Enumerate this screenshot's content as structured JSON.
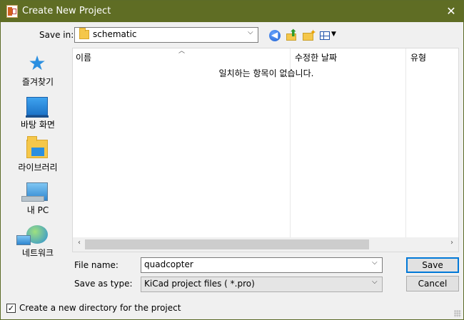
{
  "window": {
    "title": "Create New Project",
    "close_glyph": "✕"
  },
  "save_in": {
    "label": "Save in:",
    "value": "schematic",
    "arrow": "⌵"
  },
  "toolbar": {
    "back_glyph": "◀",
    "up_glyph": "⬆",
    "new_folder_glyph": "✦",
    "view_dropdown_glyph": "▼"
  },
  "places": [
    {
      "label": "즐겨찾기",
      "icon": "star-icon"
    },
    {
      "label": "바탕 화면",
      "icon": "desktop-icon"
    },
    {
      "label": "라이브러리",
      "icon": "libraries-icon"
    },
    {
      "label": "내 PC",
      "icon": "this-pc-icon"
    },
    {
      "label": "네트워크",
      "icon": "network-icon"
    }
  ],
  "file_list": {
    "columns": [
      "이름",
      "수정한 날짜",
      "유형"
    ],
    "sort_glyph": "︿",
    "empty_message": "일치하는 항목이 없습니다.",
    "scroll_left": "‹",
    "scroll_right": "›"
  },
  "file_name": {
    "label": "File name:",
    "value": "quadcopter",
    "arrow": "⌵"
  },
  "save_as_type": {
    "label": "Save as type:",
    "value": "KiCad project files ( *.pro)",
    "arrow": "⌵"
  },
  "buttons": {
    "save": "Save",
    "cancel": "Cancel"
  },
  "options": {
    "new_directory_label": "Create a new directory for the project",
    "new_directory_checked_glyph": "✓"
  }
}
